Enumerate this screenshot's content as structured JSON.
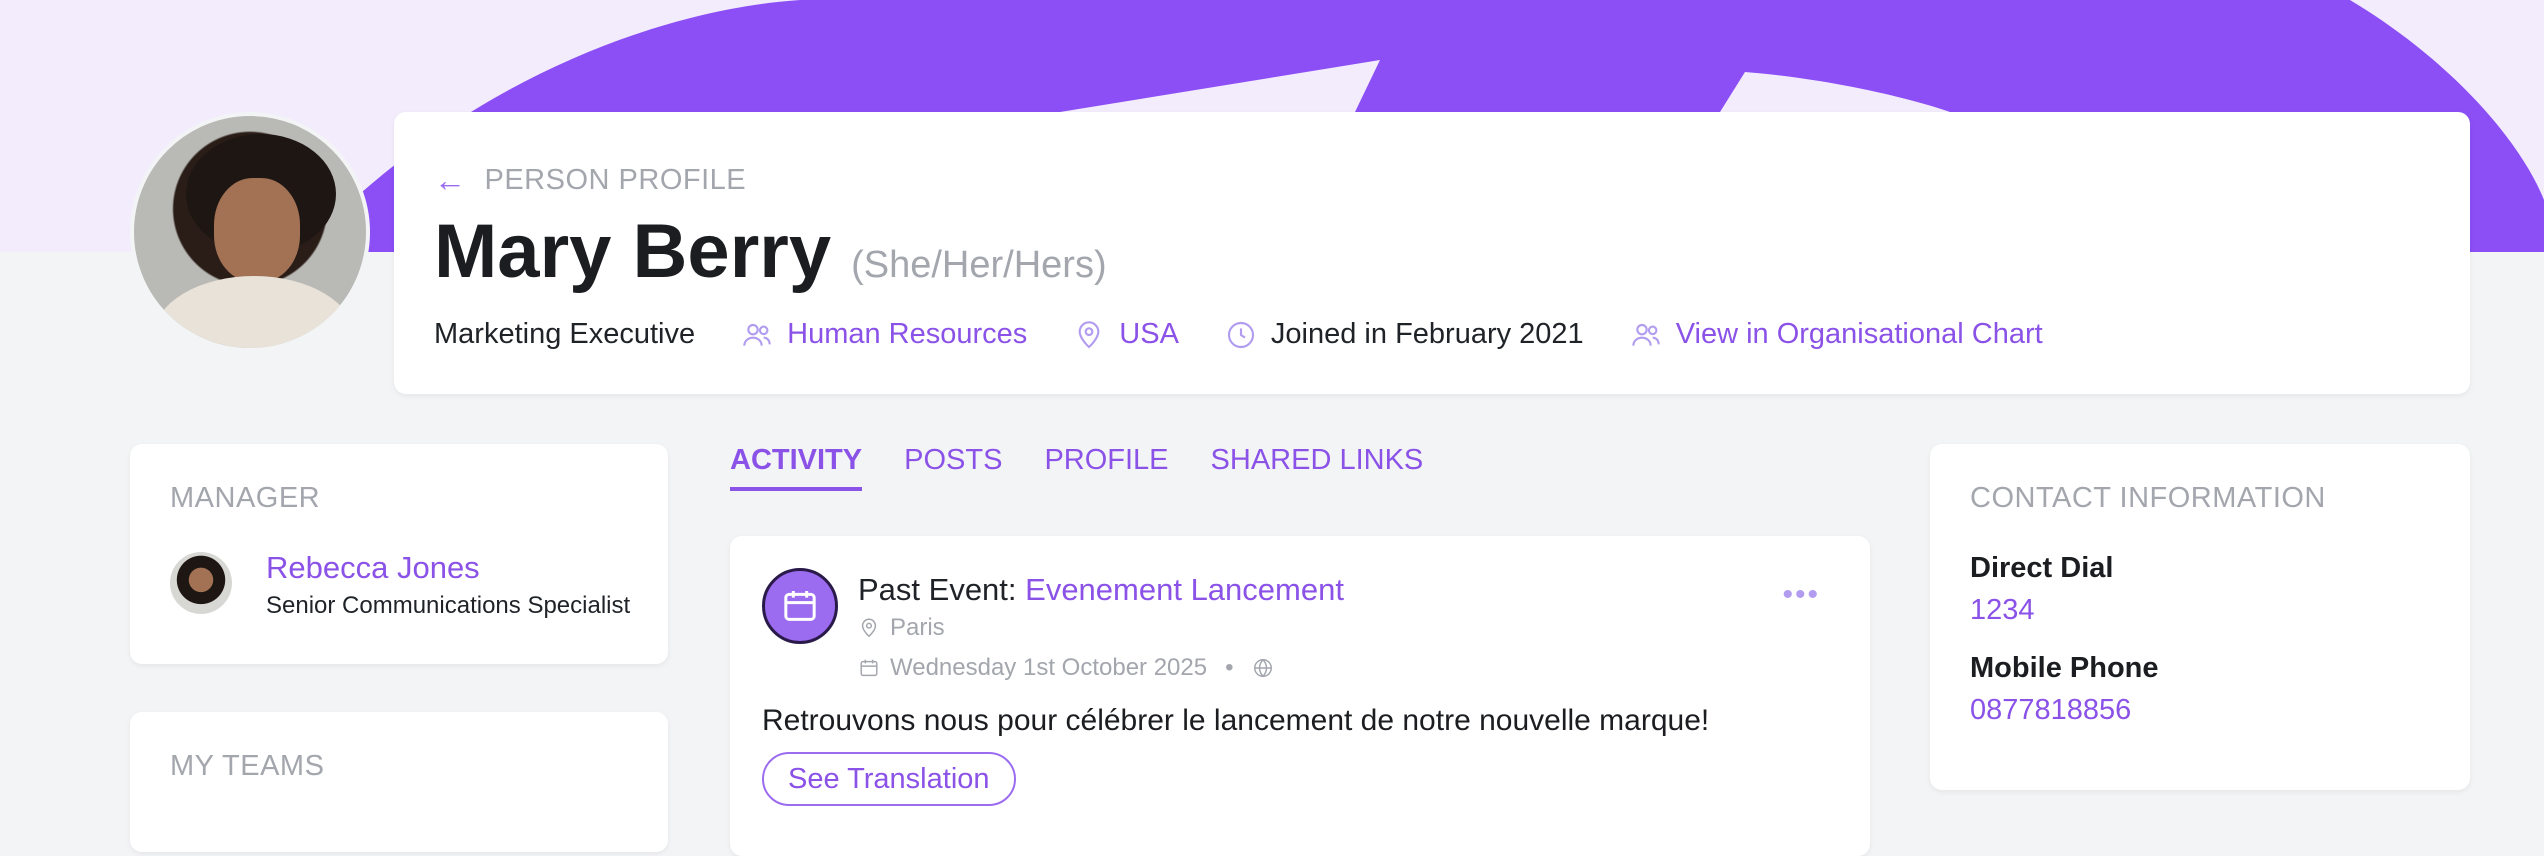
{
  "colors": {
    "accent": "#8b52e8",
    "hero_band": "#8b4ff5",
    "hero_bg": "#f3ecfd",
    "muted": "#a3a6ad"
  },
  "header": {
    "breadcrumb": "PERSON PROFILE",
    "name": "Mary Berry",
    "pronouns": "(She/Her/Hers)",
    "job_title": "Marketing Executive",
    "department": "Human Resources",
    "country": "USA",
    "joined": "Joined in February 2021",
    "org_chart_link": "View in Organisational Chart"
  },
  "manager": {
    "section_title": "MANAGER",
    "name": "Rebecca Jones",
    "role": "Senior Communications Specialist"
  },
  "teams": {
    "section_title": "MY TEAMS"
  },
  "tabs": [
    "ACTIVITY",
    "POSTS",
    "PROFILE",
    "SHARED LINKS"
  ],
  "post": {
    "prefix": "Past Event: ",
    "event_name": "Evenement Lancement",
    "location": "Paris",
    "date": "Wednesday 1st October 2025",
    "separator": "•",
    "body": "Retrouvons nous pour célébrer le lancement de notre nouvelle marque!",
    "translate_label": "See Translation",
    "more_label": "•••"
  },
  "contact": {
    "section_title": "CONTACT INFORMATION",
    "direct_dial_label": "Direct Dial",
    "direct_dial": "1234",
    "mobile_label": "Mobile Phone",
    "mobile": "0877818856"
  }
}
